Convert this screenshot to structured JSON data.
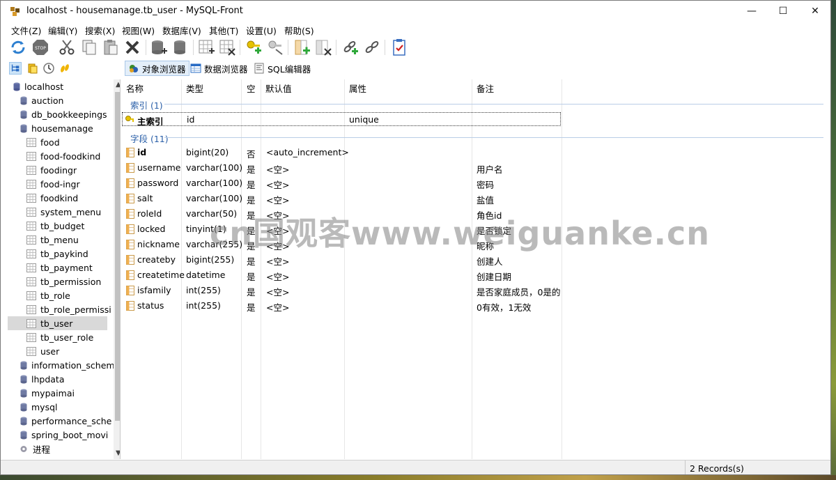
{
  "window": {
    "title": "localhost - housemanage.tb_user - MySQL-Front",
    "minimize": "—",
    "maximize": "☐",
    "close": "✕"
  },
  "menu": [
    "文件(Z)",
    "编辑(Y)",
    "搜索(X)",
    "视图(W)",
    "数据库(V)",
    "其他(T)",
    "设置(U)",
    "帮助(S)"
  ],
  "toolbar_icons": [
    "refresh-icon",
    "stop-icon",
    "cut-icon",
    "copy-icon",
    "paste-icon",
    "delete-icon",
    "new-database-icon",
    "drop-database-icon",
    "new-table-icon",
    "drop-table-icon",
    "new-user-icon",
    "edit-user-icon",
    "new-field-icon",
    "drop-field-icon",
    "new-link-icon",
    "remove-link-icon",
    "checklist-icon"
  ],
  "view_tabs": {
    "object_browser": "对象浏览器",
    "data_browser": "数据浏览器",
    "sql_editor": "SQL编辑器"
  },
  "tree": {
    "root": "localhost",
    "items": [
      {
        "label": "auction",
        "type": "db"
      },
      {
        "label": "db_bookkeepings",
        "type": "db"
      },
      {
        "label": "housemanage",
        "type": "db"
      },
      {
        "label": "food",
        "type": "table"
      },
      {
        "label": "food-foodkind",
        "type": "table"
      },
      {
        "label": "foodingr",
        "type": "table"
      },
      {
        "label": "food-ingr",
        "type": "table"
      },
      {
        "label": "foodkind",
        "type": "table"
      },
      {
        "label": "system_menu",
        "type": "table"
      },
      {
        "label": "tb_budget",
        "type": "table"
      },
      {
        "label": "tb_menu",
        "type": "table"
      },
      {
        "label": "tb_paykind",
        "type": "table"
      },
      {
        "label": "tb_payment",
        "type": "table"
      },
      {
        "label": "tb_permission",
        "type": "table"
      },
      {
        "label": "tb_role",
        "type": "table"
      },
      {
        "label": "tb_role_permissi",
        "type": "table"
      },
      {
        "label": "tb_user",
        "type": "table",
        "selected": true
      },
      {
        "label": "tb_user_role",
        "type": "table"
      },
      {
        "label": "user",
        "type": "table"
      },
      {
        "label": "information_schem",
        "type": "db"
      },
      {
        "label": "lhpdata",
        "type": "db"
      },
      {
        "label": "mypaimai",
        "type": "db"
      },
      {
        "label": "mysql",
        "type": "db"
      },
      {
        "label": "performance_sche",
        "type": "db"
      },
      {
        "label": "spring_boot_movi",
        "type": "db"
      },
      {
        "label": "进程",
        "type": "process"
      }
    ]
  },
  "grid": {
    "columns": [
      "名称",
      "类型",
      "空",
      "默认值",
      "属性",
      "备注"
    ],
    "index_group": "索引 (1)",
    "index_rows": [
      {
        "name": "主索引",
        "type": "id",
        "attr": "unique"
      }
    ],
    "field_group": "字段 (11)",
    "field_rows": [
      {
        "name": "id",
        "type": "bigint(20)",
        "null": "否",
        "default": "<auto_increment>",
        "comment": "",
        "bold": true
      },
      {
        "name": "username",
        "type": "varchar(100)",
        "null": "是",
        "default": "<空>",
        "comment": "用户名"
      },
      {
        "name": "password",
        "type": "varchar(100)",
        "null": "是",
        "default": "<空>",
        "comment": "密码"
      },
      {
        "name": "salt",
        "type": "varchar(100)",
        "null": "是",
        "default": "<空>",
        "comment": "盐值"
      },
      {
        "name": "roleId",
        "type": "varchar(50)",
        "null": "是",
        "default": "<空>",
        "comment": "角色id"
      },
      {
        "name": "locked",
        "type": "tinyint(1)",
        "null": "是",
        "default": "<空>",
        "comment": "是否锁定"
      },
      {
        "name": "nickname",
        "type": "varchar(255)",
        "null": "是",
        "default": "<空>",
        "comment": "昵称"
      },
      {
        "name": "createby",
        "type": "bigint(255)",
        "null": "是",
        "default": "<空>",
        "comment": "创建人"
      },
      {
        "name": "createtime",
        "type": "datetime",
        "null": "是",
        "default": "<空>",
        "comment": "创建日期"
      },
      {
        "name": "isfamily",
        "type": "int(255)",
        "null": "是",
        "default": "<空>",
        "comment": "是否家庭成员，0是的"
      },
      {
        "name": "status",
        "type": "int(255)",
        "null": "是",
        "default": "<空>",
        "comment": "0有效，1无效"
      }
    ]
  },
  "status": {
    "records": "2 Records(s)"
  },
  "watermark": "cn国观客www.weiguanke.cn"
}
